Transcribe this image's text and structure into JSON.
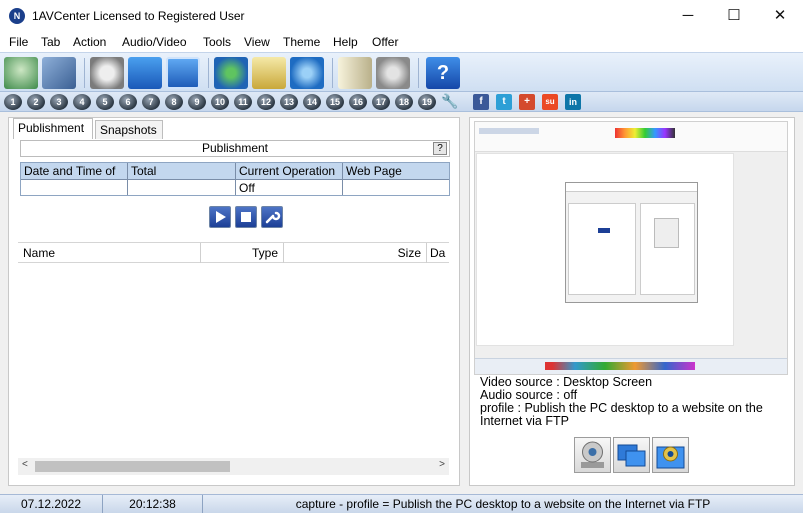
{
  "window": {
    "title": "1AVCenter Licensed to Registered User",
    "app_icon_glyph": "N",
    "min_glyph": "─",
    "max_glyph": "☐",
    "close_glyph": "✕"
  },
  "menu": [
    "File",
    "Tab",
    "Action",
    "Audio/Video",
    "Tools",
    "View",
    "Theme",
    "Help",
    "Offer"
  ],
  "toolbar": {
    "buttons": [
      "screen-recorder-icon",
      "video-film-icon",
      "webcam-icon",
      "desktop-publish-icon",
      "region-capture-icon",
      "globe-icon",
      "email-icon",
      "upload-icon",
      "book-icon",
      "settings-gears-icon",
      "help-icon"
    ]
  },
  "tab_numbers": [
    "1",
    "2",
    "3",
    "4",
    "5",
    "6",
    "7",
    "8",
    "9",
    "10",
    "11",
    "12",
    "13",
    "14",
    "15",
    "16",
    "17",
    "18",
    "19"
  ],
  "social": [
    {
      "name": "facebook-icon",
      "glyph": "f",
      "color": "#3b5998"
    },
    {
      "name": "twitter-icon",
      "glyph": "t",
      "color": "#2d9fd6"
    },
    {
      "name": "googleplus-icon",
      "glyph": "+",
      "color": "#d44a2d"
    },
    {
      "name": "stumbleupon-icon",
      "glyph": "su",
      "color": "#eb4924"
    },
    {
      "name": "linkedin-icon",
      "glyph": "in",
      "color": "#0e76a8"
    }
  ],
  "left": {
    "tabs": [
      "Publishment",
      "Snapshots"
    ],
    "section_title": "Publishment",
    "help_label": "?",
    "table": {
      "columns": [
        "Date and Time of",
        "Total",
        "Current Operation",
        "Web Page"
      ],
      "row": [
        "",
        "",
        "Off",
        ""
      ]
    },
    "file_columns": [
      "Name",
      "Type",
      "Size",
      "Da"
    ]
  },
  "right": {
    "info": [
      "Video source : Desktop Screen",
      "Audio source : off",
      "profile : Publish the PC desktop to a website on the",
      "Internet via FTP"
    ]
  },
  "status": {
    "date": "07.12.2022",
    "time": "20:12:38",
    "message": "capture - profile =  Publish the PC desktop to a website on the Internet via FTP"
  }
}
